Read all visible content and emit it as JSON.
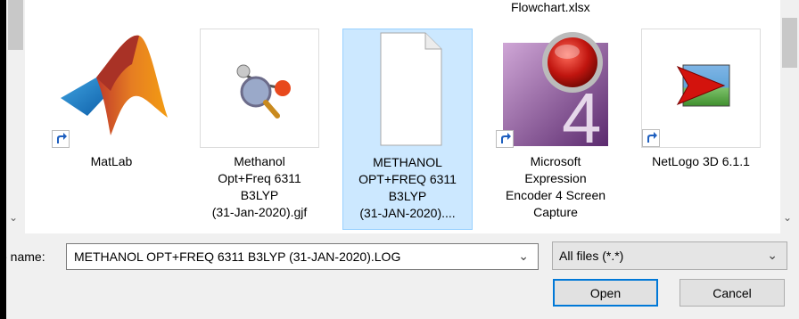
{
  "partial_top_label": "Flowchart.xlsx",
  "files": [
    {
      "lines": [
        "MatLab"
      ],
      "icon": "matlab-icon",
      "shortcut": true
    },
    {
      "lines": [
        "Methanol",
        "Opt+Freq 6311",
        "B3LYP",
        "(31-Jan-2020).gjf"
      ],
      "icon": "gaussview-molecule-icon",
      "shortcut": false
    },
    {
      "lines": [
        "METHANOL",
        "OPT+FREQ 6311",
        "B3LYP",
        "(31-JAN-2020)...."
      ],
      "icon": "blank-document-icon",
      "shortcut": false,
      "selected": true
    },
    {
      "lines": [
        "Microsoft",
        "Expression",
        "Encoder 4 Screen",
        "Capture"
      ],
      "icon": "expression-encoder-icon",
      "shortcut": true
    },
    {
      "lines": [
        "NetLogo 3D 6.1.1"
      ],
      "icon": "netlogo-icon",
      "shortcut": true
    }
  ],
  "filename": {
    "label": "e name:",
    "value": "METHANOL OPT+FREQ 6311 B3LYP (31-JAN-2020).LOG"
  },
  "filter": {
    "value": "All files (*.*)"
  },
  "buttons": {
    "open": "Open",
    "cancel": "Cancel"
  }
}
